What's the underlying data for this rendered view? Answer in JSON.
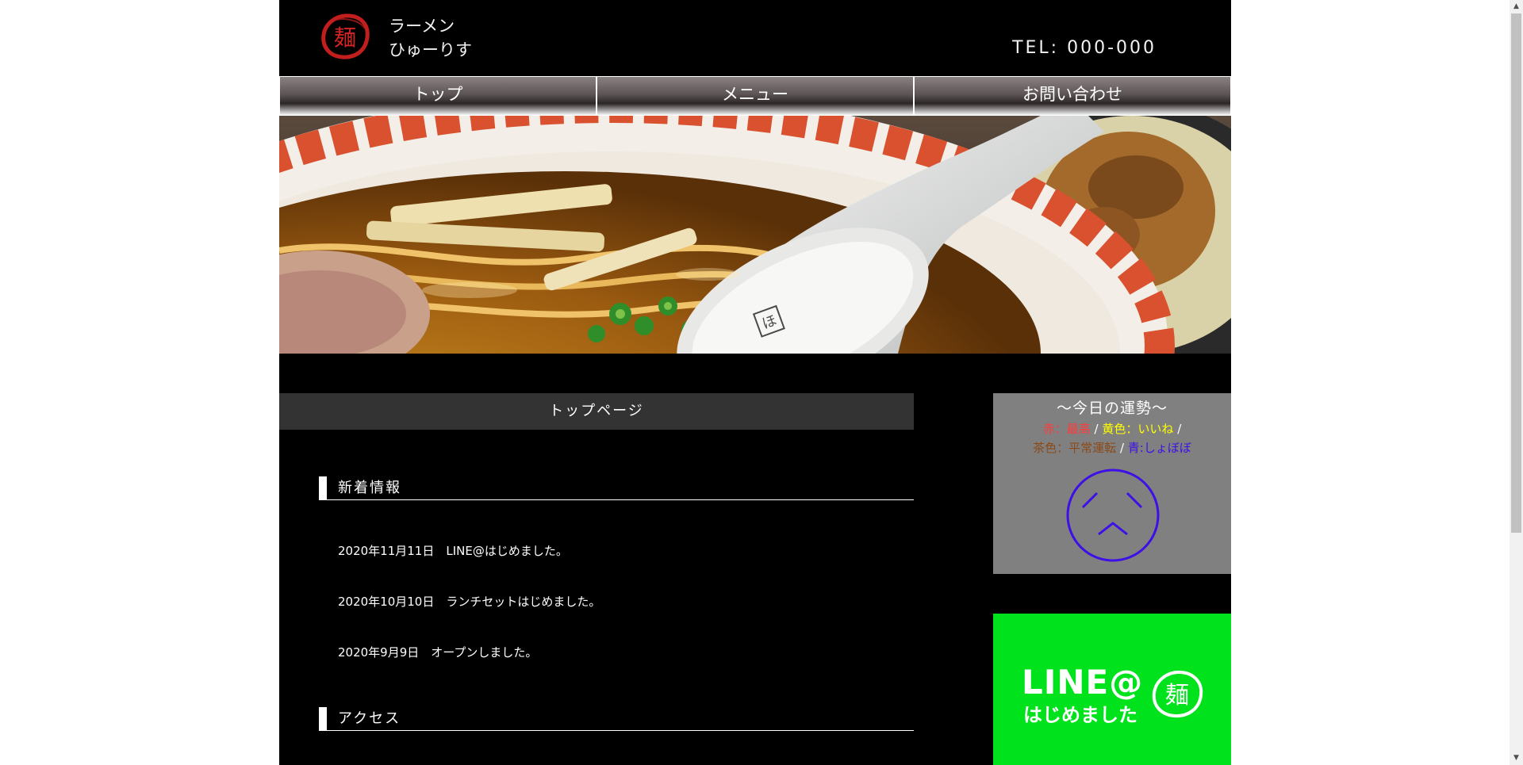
{
  "header": {
    "logo_char": "麺",
    "shop_name_line1": "ラーメン",
    "shop_name_line2": "ひゅーりす",
    "tel": "TEL: 000-000"
  },
  "nav": {
    "items": [
      {
        "label": "トップ"
      },
      {
        "label": "メニュー"
      },
      {
        "label": "お問い合わせ"
      }
    ]
  },
  "hero": {
    "spoon_char": "ほ"
  },
  "main": {
    "page_title": "トップページ",
    "news_heading": "新着情報",
    "news": [
      {
        "text": "2020年11月11日　LINE@はじめました。"
      },
      {
        "text": "2020年10月10日　ランチセットはじめました。"
      },
      {
        "text": "2020年9月9日　オープンしました。"
      }
    ],
    "access_heading": "アクセス"
  },
  "sidebar": {
    "fortune": {
      "title": "〜今日の運勢〜",
      "legend": [
        {
          "text": "赤：最高",
          "color": "#ff3b3b"
        },
        {
          "text": "黄色：いいね",
          "color": "#ffff00"
        },
        {
          "text": "茶色：平常運転",
          "color": "#8b4a1a"
        },
        {
          "text": "青:しょぼぼ",
          "color": "#3d10e8"
        }
      ],
      "separator": "/",
      "face_color": "#3d10e8"
    },
    "line_banner": {
      "line1": "LINE@",
      "line2": "はじめました",
      "logo_char": "麺"
    }
  },
  "colors": {
    "page_bg": "#000000",
    "title_bar": "#333333",
    "fortune_bg": "#808080",
    "line_green": "#00e31c"
  }
}
